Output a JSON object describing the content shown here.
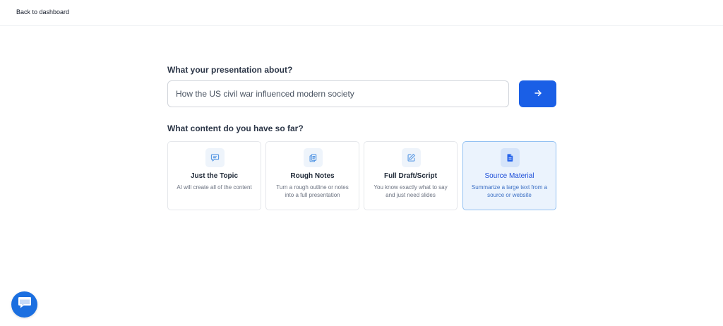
{
  "header": {
    "back_label": "Back to dashboard"
  },
  "topic": {
    "question": "What your presentation about?",
    "value": "How the US civil war influenced modern society",
    "submit_icon": "arrow-right-icon"
  },
  "content": {
    "question": "What content do you have so far?",
    "options": [
      {
        "title": "Just the Topic",
        "description": "AI will create all of the content",
        "icon": "message-square-icon",
        "selected": false
      },
      {
        "title": "Rough Notes",
        "description": "Turn a rough outline or notes into a full presentation",
        "icon": "copy-documents-icon",
        "selected": false
      },
      {
        "title": "Full Draft/Script",
        "description": "You know exactly what to say and just need slides",
        "icon": "edit-pencil-icon",
        "selected": false
      },
      {
        "title": "Source Material",
        "description": "Summarize a large text from a source or website",
        "icon": "file-text-icon",
        "selected": true
      }
    ]
  },
  "chat": {
    "icon": "chat-bubble-icon"
  },
  "colors": {
    "accent": "#1a5fe6",
    "selected_bg": "#ebf3fd",
    "selected_border": "#93c1f2",
    "chat": "#1b6fe0"
  }
}
